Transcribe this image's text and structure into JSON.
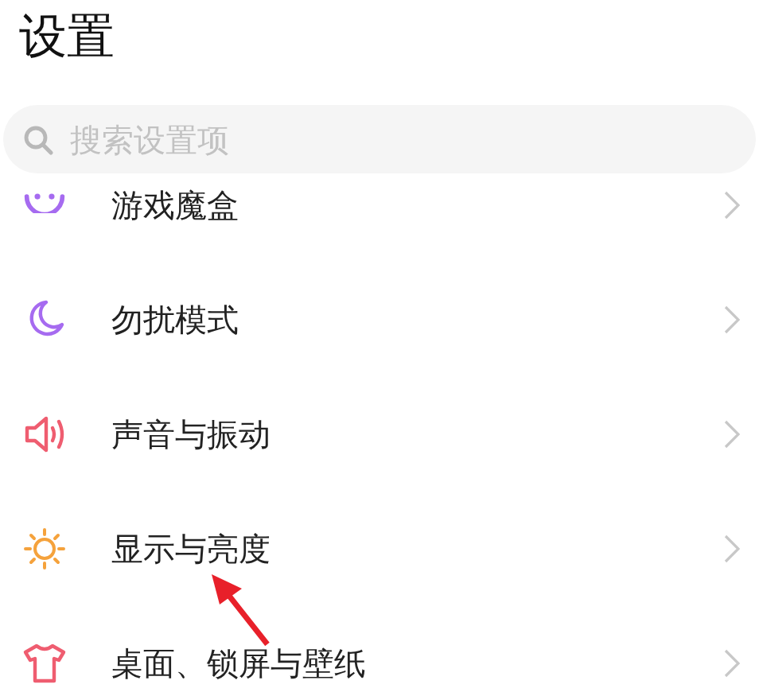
{
  "title": "设置",
  "search": {
    "placeholder": "搜索设置项"
  },
  "items": [
    {
      "label": "游戏魔盒",
      "kind": "game"
    },
    {
      "label": "勿扰模式",
      "kind": "moon"
    },
    {
      "label": "声音与振动",
      "kind": "sound"
    },
    {
      "label": "显示与亮度",
      "kind": "sun"
    },
    {
      "label": "桌面、锁屏与壁纸",
      "kind": "shirt"
    }
  ]
}
